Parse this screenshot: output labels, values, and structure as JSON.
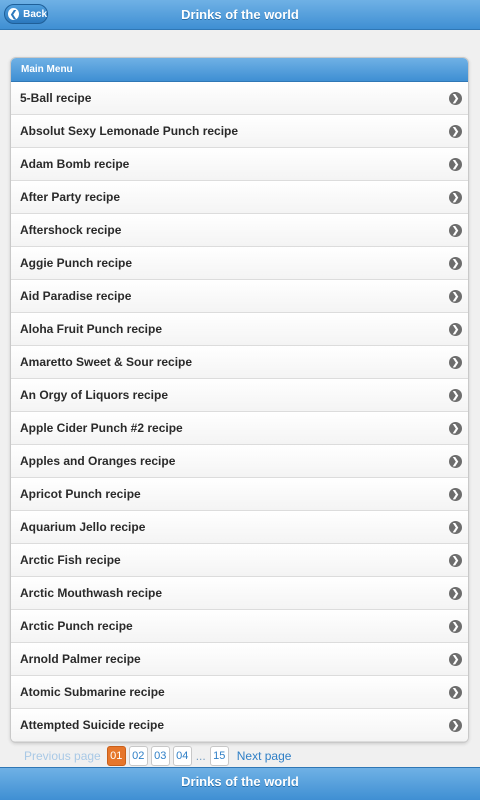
{
  "header": {
    "title": "Drinks of the world",
    "back_label": "Back",
    "back_icon": "chevron-left-icon"
  },
  "menu": {
    "title": "Main Menu",
    "items": [
      {
        "label": "5-Ball recipe"
      },
      {
        "label": "Absolut Sexy Lemonade Punch recipe"
      },
      {
        "label": "Adam Bomb recipe"
      },
      {
        "label": "After Party recipe"
      },
      {
        "label": "Aftershock recipe"
      },
      {
        "label": "Aggie Punch recipe"
      },
      {
        "label": "Aid Paradise recipe"
      },
      {
        "label": "Aloha Fruit Punch recipe"
      },
      {
        "label": "Amaretto Sweet & Sour recipe"
      },
      {
        "label": "An Orgy of Liquors recipe"
      },
      {
        "label": "Apple Cider Punch #2 recipe"
      },
      {
        "label": "Apples and Oranges recipe"
      },
      {
        "label": "Apricot Punch recipe"
      },
      {
        "label": "Aquarium Jello recipe"
      },
      {
        "label": "Arctic Fish recipe"
      },
      {
        "label": "Arctic Mouthwash recipe"
      },
      {
        "label": "Arctic Punch recipe"
      },
      {
        "label": "Arnold Palmer recipe"
      },
      {
        "label": "Atomic Submarine recipe"
      },
      {
        "label": "Attempted Suicide recipe"
      }
    ],
    "item_icon": "chevron-right-icon"
  },
  "pager": {
    "previous_label": "Previous page",
    "pages": [
      "01",
      "02",
      "03",
      "04"
    ],
    "current": "01",
    "ellipsis": "...",
    "last": "15",
    "next_label": "Next page"
  },
  "footer": {
    "title": "Drinks of the world"
  },
  "colors": {
    "bar_blue": "#3f8fd3",
    "active_page": "#e6762b",
    "link_blue": "#2f7fc6"
  }
}
